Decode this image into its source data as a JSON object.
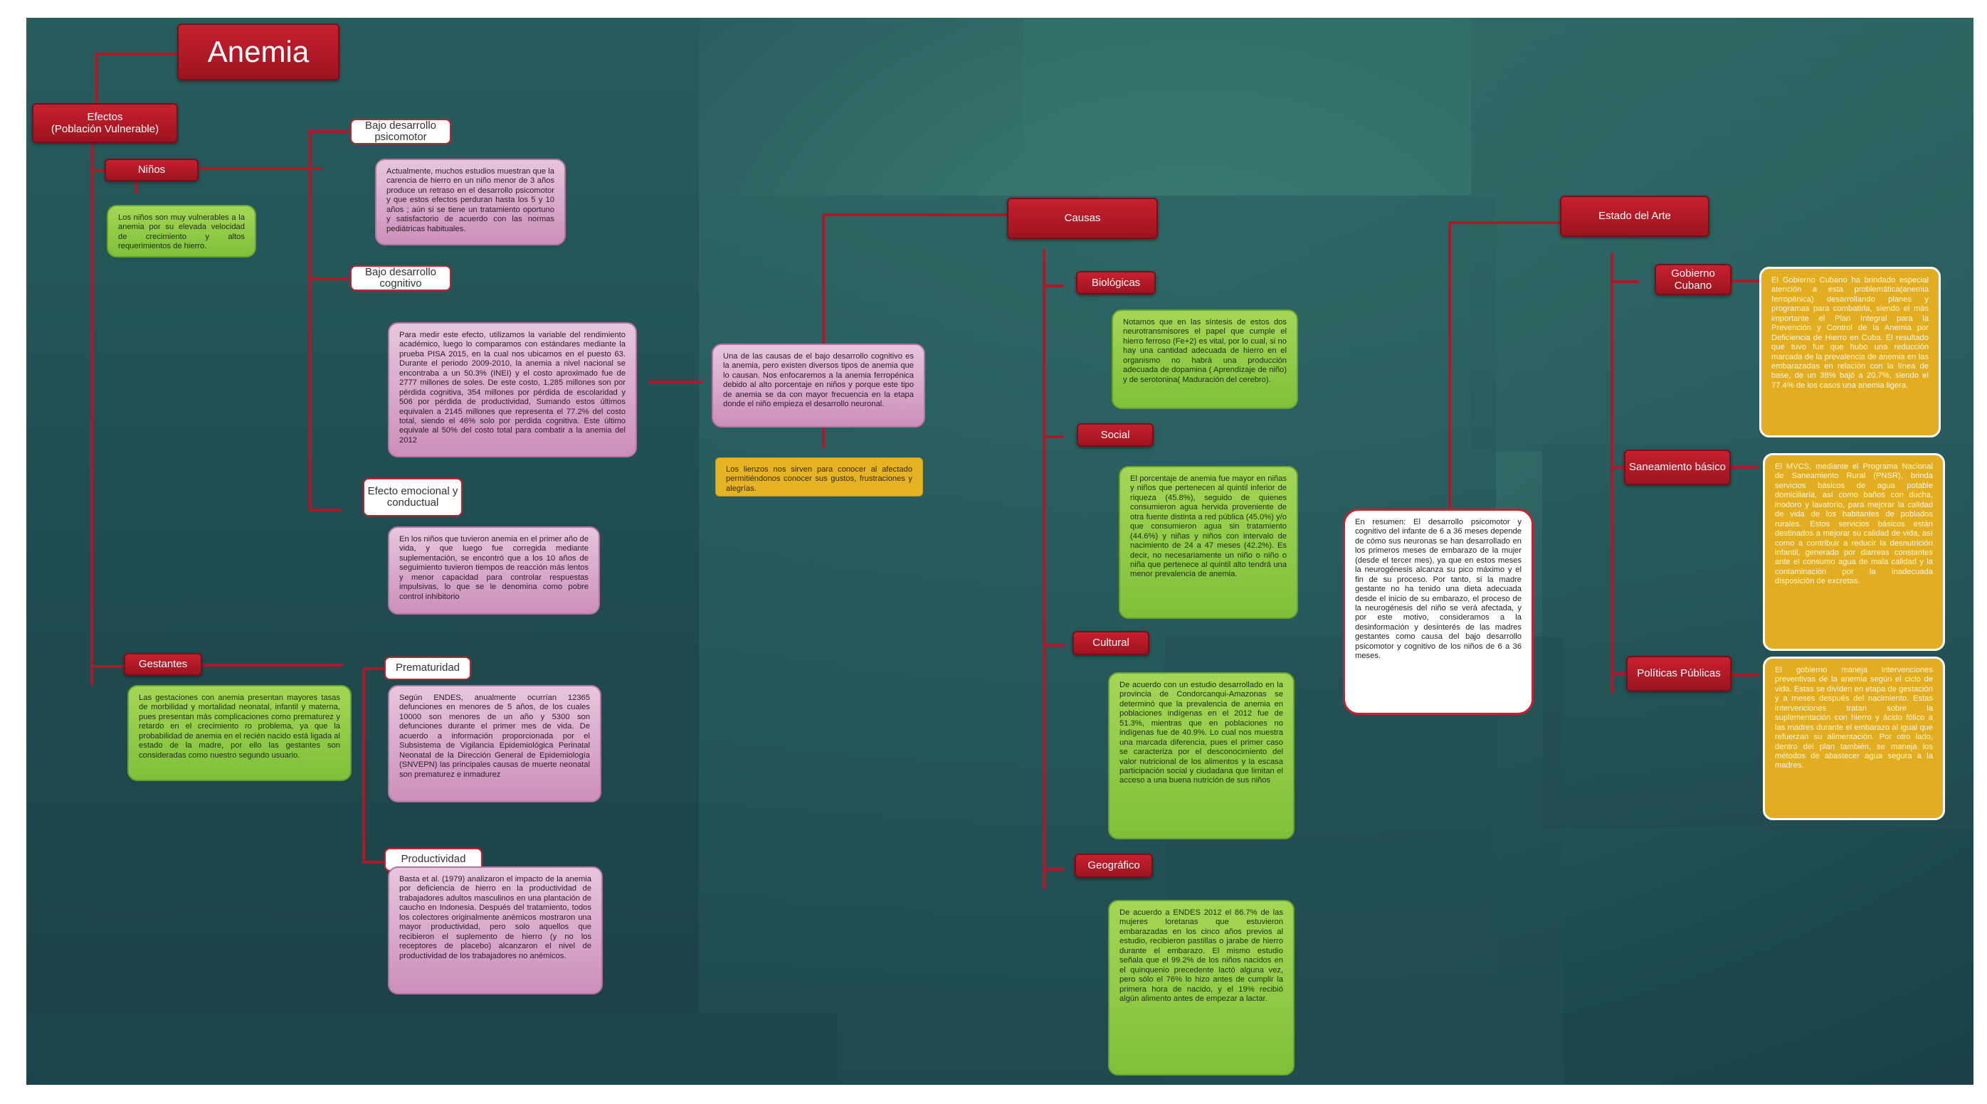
{
  "title": "Anemia",
  "efectos": {
    "label": "Efectos\n(Población Vulnerable)",
    "ninos": {
      "label": "Niños",
      "desc": "Los niños son muy vulnerables a la anemia por su elevada velocidad de crecimiento y altos requerimientos de hierro.",
      "psicomotor_label": "Bajo desarrollo psicomotor",
      "psicomotor_text": "Actualmente, muchos estudios muestran que la carencia de hierro en un niño menor de 3 años produce un retraso en el desarrollo psicomotor y que estos efectos perduran hasta los 5 y 10 años ; aún si se tiene un tratamiento oportuno y satisfactorio de acuerdo con las normas pediátricas habituales.",
      "cognitivo_label": "Bajo desarrollo cognitivo",
      "cognitivo_text": "Para medir este efecto, utilizamos la variable del rendimiento académico, luego lo comparamos con estándares mediante la prueba PISA 2015, en la cual nos ubicamos en el puesto 63. Durante el periodo 2009-2010, la anemia a nivel nacional se encontraba a un 50.3% (INEI) y el costo aproximado fue de 2777 millones de soles. De este costo, 1,285 millones son por pérdida cognitiva, 354 millones por pérdida de escolaridad y 506 por pérdida de productividad, Sumando estos últimos equivalen a 2145 millones que representa el 77.2% del costo total, siendo el 46% solo por perdida cognitiva. Este último equivale al 50% del costo total para combatir a la anemia del 2012",
      "emocional_label": "Efecto emocional y conductual",
      "emocional_text": "En los niños que tuvieron anemia en el primer año de vida, y que luego fue corregida mediante suplementación, se encontró que a los 10 años de seguimiento tuvieron tiempos de reacción más lentos y menor capacidad para controlar respuestas impulsivas, lo que se le denomina como pobre control inhibitorio"
    },
    "gestantes": {
      "label": "Gestantes",
      "desc": "Las gestaciones con anemia presentan mayores tasas de morbilidad y mortalidad neonatal, infantil y materna, pues presentan más complicaciones como prematurez y retardo en el crecimiento ro problema, ya que la probabilidad de anemia en el recién nacido está ligada al estado de la madre, por ello las gestantes son consideradas como nuestro segundo usuario.",
      "prematuridad_label": "Prematuridad",
      "prematuridad_text": "Según ENDES, anualmente ocurrían 12365 defunciones en menores de 5 años, de los cuales 10000 son menores de un año y 5300 son defunciones durante el primer mes de vida. De acuerdo a información proporcionada por el Subsistema de Vigilancia Epidemiológica Perinatal Neonatal de la Dirección General de Epidemiología (SNVEPN) las principales causas de muerte neonatal son prematurez e inmadurez",
      "productividad_label": "Productividad",
      "productividad_text": "Basta et al. (1979) analizaron el impacto de la anemia por deficiencia de hierro en la productividad de trabajadores adultos masculinos en una plantación de caucho en Indonesia. Después del tratamiento, todos los colectores originalmente anémicos mostraron una mayor productividad, pero solo aquellos que recibieron el suplemento de hierro (y no los receptores de placebo) alcanzaron el nivel de productividad de los trabajadores no anémicos."
    }
  },
  "center": {
    "text": "Una de las causas de el bajo desarrollo cognitivo es la anemia, pero existen diversos tipos de anemia que lo causan. Nos enfocaremos a la anemia ferropénica debido al alto porcentaje en niños y porque este tipo de anemia se da con mayor frecuencia en la etapa donde el niño empieza el desarrollo neuronal.",
    "note": "Los lienzos nos sirven para conocer al afectado permitiéndonos conocer sus gustos, frustraciones y alegrías."
  },
  "causas": {
    "label": "Causas",
    "biologicas_label": "Biológicas",
    "biologicas_text": "Notamos que en las síntesis de estos dos neurotransmisores el papel que cumple el hierro ferroso (Fe+2) es vital, por lo cual, si no hay una cantidad adecuada de hierro en el organismo no habrá una producción adecuada de dopamina ( Aprendizaje de niño) y de serotonina( Maduración del cerebro).",
    "social_label": "Social",
    "social_text": "El porcentaje de anemia fue mayor en niñas y niños que pertenecen al quintil inferior de riqueza (45.8%), seguido de quienes consumieron agua hervida proveniente de otra fuente distinta a red pública (45.0%) y/o que consumieron agua sin tratamiento (44.6%) y niñas y niños con intervalo de nacimiento de 24 a 47 meses (42.2%). Es decir, no necesariamente un niño o niño o niña que pertenece al quintil alto tendrá una menor prevalencia de anemia.",
    "cultural_label": "Cultural",
    "cultural_text": "De acuerdo con un estudio desarrollado en la provincia de Condorcanqui-Amazonas se determinó que la prevalencia de anemia en poblaciones indígenas en el 2012 fue de 51.3%, mientras que en poblaciones no indígenas fue de 40.9%. Lo cual nos muestra una marcada diferencia, pues el primer caso se caracteriza por el desconocimiento del valor nutricional de los alimentos y la escasa participación social y ciudadana que limitan el acceso a una buena nutrición de sus niños",
    "geografico_label": "Geográfico",
    "geografico_text": "De acuerdo a ENDES 2012 el 86.7% de las mujeres loretanas que estuvieron embarazadas en los cinco años previos al estudio, recibieron pastillas o jarabe de hierro durante el embarazo. El mismo estudio señala que el 99.2% de los niños nacidos en el quinquenio precedente lactó alguna vez, pero sólo el 76% lo hizo antes de cumplir la primera hora de nacido, y el 19% recibió algún alimento antes de empezar a lactar."
  },
  "resumen": "En resumen: El desarrollo psicomotor y cognitivo del infante de 6 a 36 meses depende de cómo sus neuronas se han desarrollado en los primeros meses de embarazo de la mujer (desde el tercer mes), ya que en estos meses la neurogénesis alcanza su pico máximo y el fin de su proceso. Por tanto, si la madre gestante no ha tenido una dieta adecuada desde el inicio de su embarazo, el proceso de la neurogénesis del niño se verá afectada, y por este motivo, consideramos a la desinformación y desinterés de las madres gestantes como causa del bajo desarrollo psicomotor y cognitivo de los niños de 6 a 36 meses.",
  "estado": {
    "label": "Estado del Arte",
    "gobierno_label": "Gobierno Cubano",
    "gobierno_text": "El Gobierno Cubano ha brindado especial atención a esta problemática(anemia ferropénica) desarrollando planes y programas para combatirla, siendo el más importante el Plan Integral para la Prevención y Control de la Anemia por Deficiencia de Hierro en Cuba. El resultado que tuvo fue que hubo una reducción marcada de la prevalencia de anemia en las embarazadas en relación con la línea de base, de un 38% bajó a 20.7%, siendo el 77.4% de los casos una anemia ligera.",
    "saneamiento_label": "Saneamiento básico",
    "saneamiento_text": "El MVCS, mediante el Programa Nacional de Saneamiento Rural (PNSR), brinda servicios básicos de agua potable domiciliaria, así como baños con ducha, inodoro y lavatorio, para mejorar la calidad de vida de los habitantes de poblados rurales. Estos servicios básicos están destinados a mejorar su calidad de vida, así como a contribuir a reducir la desnutrición infantil, generado por diarreas constantes ante el consumo agua de mala calidad y la contaminación por la inadecuada disposición de excretas.",
    "politicas_label": "Políticas Públicas",
    "politicas_text": "El gobierno maneja intervenciones preventivas de la anemia según el ciclo de vida. Estas se dividen en etapa de gestación y a meses después del nacimiento. Estas intervenciones tratan sobre la suplementación con hierro y ácido fólico a las madres durante el embarazo al igual que refuerzan su alimentación. Por otro lado, dentro del plan también, se maneja los métodos de abastecer agua segura a la madres."
  },
  "colors": {
    "node_red": "#c8202e",
    "line_red": "#b0182a",
    "pink": "#d9a8ca",
    "green": "#8cc63f",
    "yellow": "#e3ad21"
  }
}
